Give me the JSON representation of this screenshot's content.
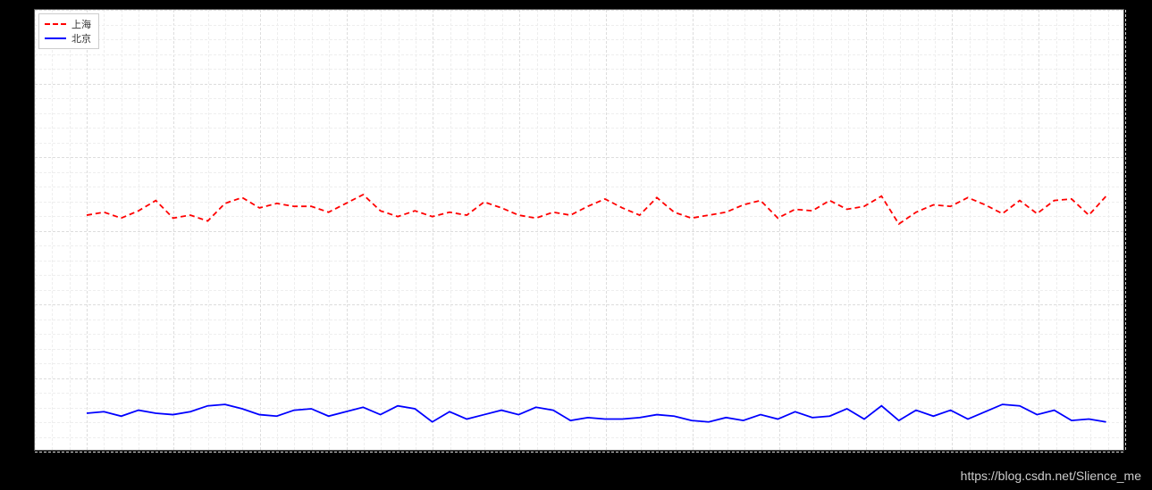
{
  "chart_data": {
    "type": "line",
    "x": [
      0,
      1,
      2,
      3,
      4,
      5,
      6,
      7,
      8,
      9,
      10,
      11,
      12,
      13,
      14,
      15,
      16,
      17,
      18,
      19,
      20,
      21,
      22,
      23,
      24,
      25,
      26,
      27,
      28,
      29,
      30,
      31,
      32,
      33,
      34,
      35,
      36,
      37,
      38,
      39,
      40,
      41,
      42,
      43,
      44,
      45,
      46,
      47,
      48,
      49,
      50,
      51,
      52,
      53,
      54,
      55,
      56,
      57,
      58,
      59
    ],
    "series": [
      {
        "name": "上海",
        "color": "red",
        "style": "dashed",
        "values": [
          16.0,
          16.2,
          15.8,
          16.3,
          17.0,
          15.8,
          16.0,
          15.6,
          16.8,
          17.2,
          16.5,
          16.8,
          16.6,
          16.6,
          16.2,
          16.8,
          17.4,
          16.3,
          15.9,
          16.3,
          15.9,
          16.2,
          16.0,
          16.9,
          16.5,
          16.0,
          15.8,
          16.2,
          16.0,
          16.6,
          17.1,
          16.5,
          16.0,
          17.2,
          16.2,
          15.8,
          16.0,
          16.2,
          16.7,
          17.0,
          15.8,
          16.4,
          16.3,
          17.0,
          16.4,
          16.6,
          17.3,
          15.4,
          16.2,
          16.7,
          16.6,
          17.2,
          16.7,
          16.1,
          17.0,
          16.1,
          17.0,
          17.1,
          16.0,
          17.3
        ]
      },
      {
        "name": "北京",
        "color": "blue",
        "style": "solid",
        "values": [
          2.5,
          2.6,
          2.3,
          2.7,
          2.5,
          2.4,
          2.6,
          3.0,
          3.1,
          2.8,
          2.4,
          2.3,
          2.7,
          2.8,
          2.3,
          2.6,
          2.9,
          2.4,
          3.0,
          2.8,
          1.9,
          2.6,
          2.1,
          2.4,
          2.7,
          2.4,
          2.9,
          2.7,
          2.0,
          2.2,
          2.1,
          2.1,
          2.2,
          2.4,
          2.3,
          2.0,
          1.9,
          2.2,
          2.0,
          2.4,
          2.1,
          2.6,
          2.2,
          2.3,
          2.8,
          2.1,
          3.0,
          2.0,
          2.7,
          2.3,
          2.7,
          2.1,
          2.6,
          3.1,
          3.0,
          2.4,
          2.7,
          2.0,
          2.1,
          1.9
        ]
      }
    ],
    "legend_position": "upper-left",
    "xlim": [
      -3,
      60
    ],
    "ylim": [
      0,
      30
    ],
    "x_grid_step": 5,
    "y_grid_step": 5,
    "minor_grid": true
  },
  "legend": {
    "items": [
      {
        "label": "上海",
        "style": "dashed",
        "color": "red"
      },
      {
        "label": "北京",
        "style": "solid",
        "color": "blue"
      }
    ]
  },
  "watermark": "https://blog.csdn.net/Slience_me"
}
